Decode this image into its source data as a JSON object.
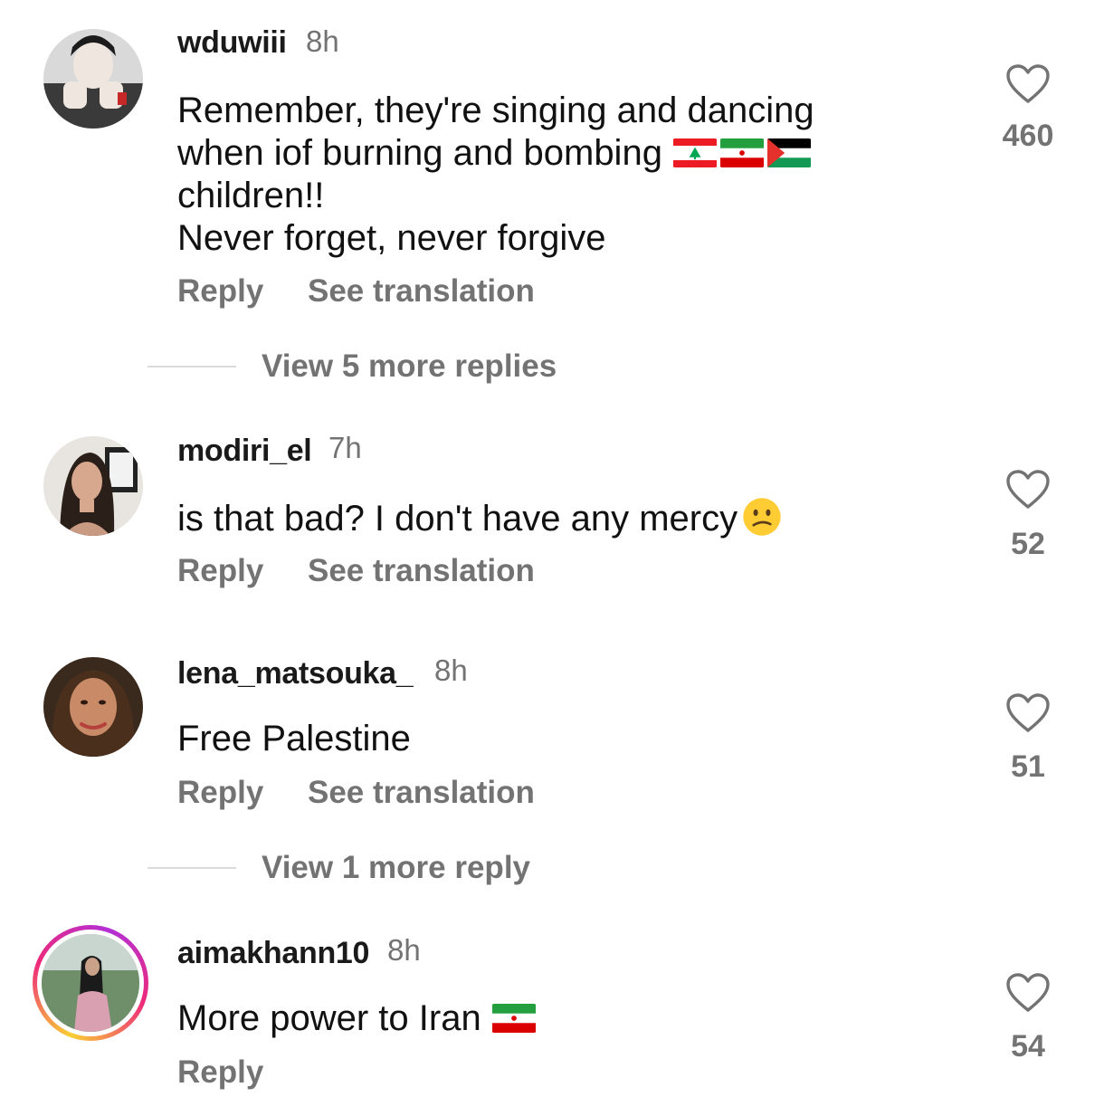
{
  "comments": [
    {
      "username": "wduwiii",
      "time": "8h",
      "lines": [
        "Remember, they're singing and dancing",
        "when iof burning and bombing",
        "children!!",
        "Never forget, never forgive"
      ],
      "flags": [
        "lebanon-flag",
        "iran-flag",
        "palestine-flag"
      ],
      "reply_label": "Reply",
      "translate_label": "See translation",
      "likes": "460",
      "more_replies": "View 5 more replies"
    },
    {
      "username": "modiri_el",
      "time": "7h",
      "lines": [
        "is that bad? I don't have any mercy"
      ],
      "emoji": "confused-face-icon",
      "reply_label": "Reply",
      "translate_label": "See translation",
      "likes": "52"
    },
    {
      "username": "lena_matsouka_",
      "time": "8h",
      "lines": [
        "Free Palestine"
      ],
      "reply_label": "Reply",
      "translate_label": "See translation",
      "likes": "51",
      "more_replies": "View 1 more reply"
    },
    {
      "username": "aimakhann10",
      "time": "8h",
      "lines": [
        "More power to Iran"
      ],
      "flags": [
        "iran-flag"
      ],
      "reply_label": "Reply",
      "likes": "54",
      "has_story_ring": true
    }
  ],
  "colors": {
    "text": "#111111",
    "secondary": "#737373",
    "divider": "#dbdbdb",
    "story_ring": [
      "#f9ce34",
      "#ee2a7b",
      "#b230d6"
    ]
  }
}
